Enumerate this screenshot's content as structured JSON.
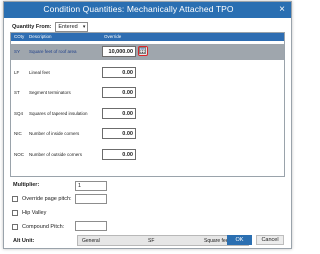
{
  "dialog": {
    "title": "Condition Quantities: Mechanically Attached TPO",
    "close_symbol": "×"
  },
  "quantity_from": {
    "label": "Quantity From:",
    "value": "Entered"
  },
  "grid": {
    "columns": [
      "COty",
      "Description",
      "Override"
    ],
    "rows": [
      {
        "uom": "SY",
        "description": "Square feet of roof area",
        "override": "10,000.00"
      },
      {
        "uom": "LF",
        "description": "Lineal feet",
        "override": "0.00"
      },
      {
        "uom": "ST",
        "description": "Segment terminators",
        "override": "0.00"
      },
      {
        "uom": "SQ4",
        "description": "Squares of tapered insulation",
        "override": "0.00"
      },
      {
        "uom": "NIC",
        "description": "Number of inside corners",
        "override": "0.00"
      },
      {
        "uom": "NOC",
        "description": "Number of outside corners",
        "override": "0.00"
      }
    ]
  },
  "multiplier": {
    "label": "Multiplier:",
    "value": "1"
  },
  "override_pitch": {
    "label": "Override page pitch:",
    "value": ""
  },
  "hip_valley": {
    "label": "Hip Valley"
  },
  "compound_pitch": {
    "label": "Compound Pitch:",
    "value": ""
  },
  "alt_unit": {
    "label": "Alt Unit:",
    "category": "General",
    "unit": "SF",
    "name": "Square feet o"
  },
  "buttons": {
    "ok": "OK",
    "cancel": "Cancel"
  }
}
